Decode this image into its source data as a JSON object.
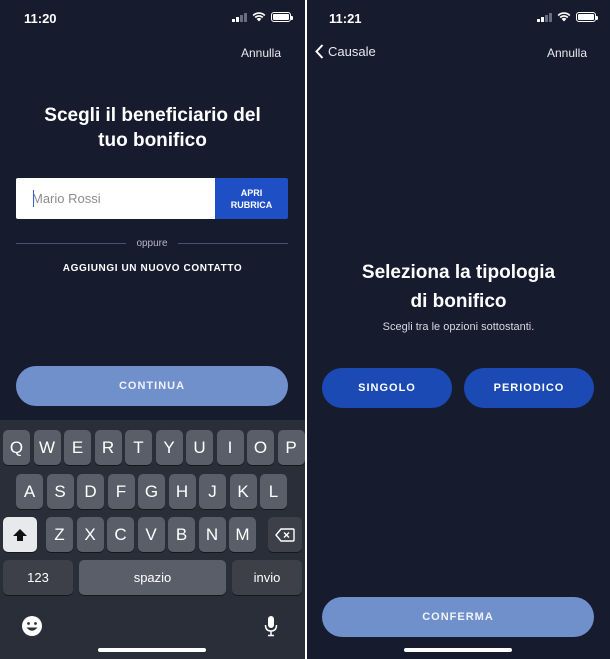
{
  "left_screen": {
    "status": {
      "time": "11:20"
    },
    "cancel_label": "Annulla",
    "title_line1": "Scegli il beneficiario del",
    "title_line2": "tuo bonifico",
    "name_placeholder": "Mario Rossi",
    "open_contacts_line1": "APRI",
    "open_contacts_line2": "RUBRICA",
    "or_label": "oppure",
    "add_contact_label": "AGGIUNGI UN NUOVO CONTATTO",
    "continue_label": "CONTINUA",
    "keyboard": {
      "row1": [
        "Q",
        "W",
        "E",
        "R",
        "T",
        "Y",
        "U",
        "I",
        "O",
        "P"
      ],
      "row2": [
        "A",
        "S",
        "D",
        "F",
        "G",
        "H",
        "J",
        "K",
        "L"
      ],
      "row3": [
        "Z",
        "X",
        "C",
        "V",
        "B",
        "N",
        "M"
      ],
      "numbers_label": "123",
      "space_label": "spazio",
      "return_label": "invio"
    }
  },
  "right_screen": {
    "status": {
      "time": "11:21"
    },
    "back_label": "Causale",
    "cancel_label": "Annulla",
    "title_line1": "Seleziona la tipologia",
    "title_line2": "di bonifico",
    "subtitle": "Scegli tra le opzioni sottostanti.",
    "single_label": "SINGOLO",
    "periodic_label": "PERIODICO",
    "confirm_label": "CONFERMA"
  },
  "colors": {
    "background": "#161b2e",
    "primary_button": "#1c4ab5",
    "disabled_button": "#7090cc",
    "keyboard_bg": "#2a2e38"
  },
  "icons": [
    "cellular-signal-icon",
    "wifi-icon",
    "battery-icon",
    "chevron-left-icon",
    "backspace-icon",
    "shift-icon",
    "emoji-icon",
    "microphone-icon"
  ]
}
